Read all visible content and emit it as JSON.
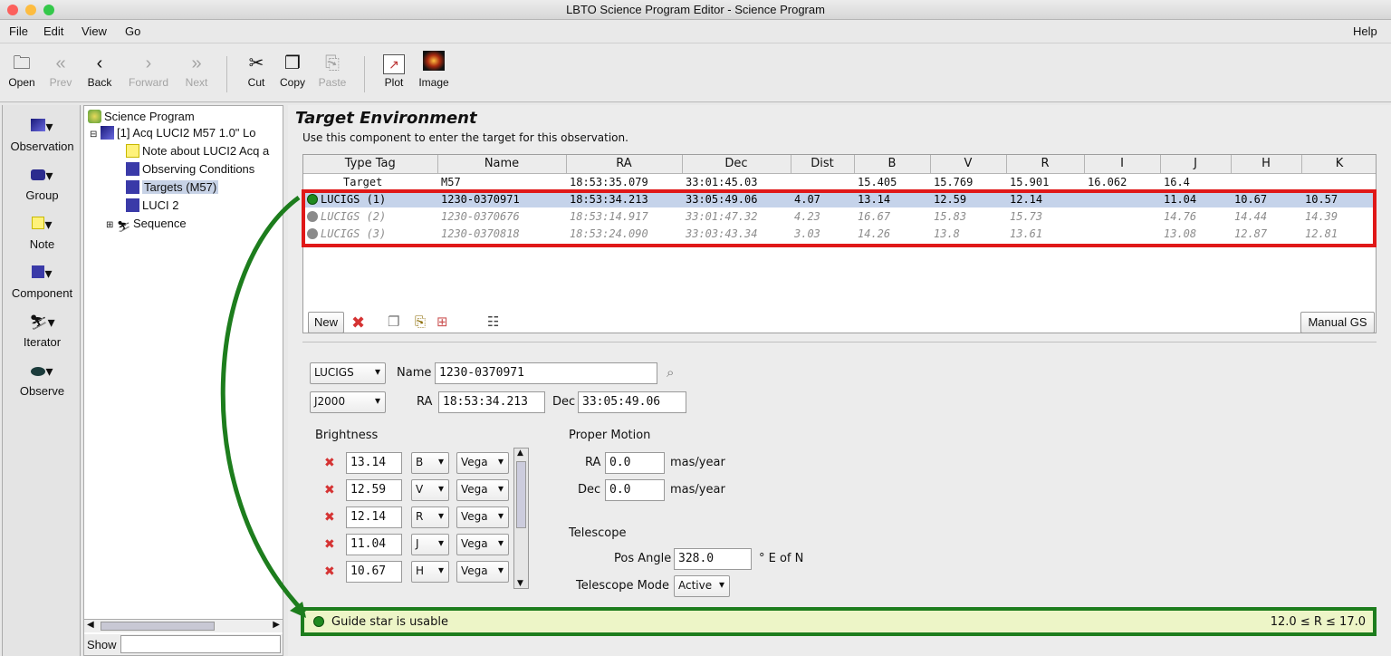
{
  "window": {
    "title": "LBTO Science Program Editor - Science Program"
  },
  "menu": {
    "file": "File",
    "edit": "Edit",
    "view": "View",
    "go": "Go",
    "help": "Help"
  },
  "toolbar": {
    "open": "Open",
    "prev": "Prev",
    "back": "Back",
    "forward": "Forward",
    "next": "Next",
    "cut": "Cut",
    "copy": "Copy",
    "paste": "Paste",
    "plot": "Plot",
    "image": "Image"
  },
  "palette": {
    "observation": "Observation",
    "group": "Group",
    "note": "Note",
    "component": "Component",
    "iterator": "Iterator",
    "observe": "Observe"
  },
  "tree": {
    "root": "Science Program",
    "obs": "[1] Acq LUCI2 M57 1.0\" Lo",
    "note": "Note about LUCI2 Acq a",
    "conditions": "Observing Conditions",
    "targets": "Targets (M57)",
    "luci": "LUCI 2",
    "sequence": "Sequence",
    "show_label": "Show"
  },
  "target_env": {
    "heading": "Target Environment",
    "subtitle": "Use this component to enter the target for this observation.",
    "columns": [
      "Type Tag",
      "Name",
      "RA",
      "Dec",
      "Dist",
      "B",
      "V",
      "R",
      "I",
      "J",
      "H",
      "K"
    ],
    "rows": [
      {
        "tag": "Target",
        "name": "M57",
        "ra": "18:53:35.079",
        "dec": "33:01:45.03",
        "dist": "",
        "b": "15.405",
        "v": "15.769",
        "r": "15.901",
        "i": "16.062",
        "j": "16.4",
        "h": "",
        "k": ""
      },
      {
        "tag": "LUCIGS (1)",
        "name": "1230-0370971",
        "ra": "18:53:34.213",
        "dec": "33:05:49.06",
        "dist": "4.07",
        "b": "13.14",
        "v": "12.59",
        "r": "12.14",
        "i": "",
        "j": "11.04",
        "h": "10.67",
        "k": "10.57"
      },
      {
        "tag": "LUCIGS (2)",
        "name": "1230-0370676",
        "ra": "18:53:14.917",
        "dec": "33:01:47.32",
        "dist": "4.23",
        "b": "16.67",
        "v": "15.83",
        "r": "15.73",
        "i": "",
        "j": "14.76",
        "h": "14.44",
        "k": "14.39"
      },
      {
        "tag": "LUCIGS (3)",
        "name": "1230-0370818",
        "ra": "18:53:24.090",
        "dec": "33:03:43.34",
        "dist": "3.03",
        "b": "14.26",
        "v": "13.8",
        "r": "13.61",
        "i": "",
        "j": "13.08",
        "h": "12.87",
        "k": "12.81"
      }
    ],
    "new_button": "New",
    "manual_gs_button": "Manual GS"
  },
  "detail": {
    "tag_value": "LUCIGS",
    "name_label": "Name",
    "name_value": "1230-0370971",
    "system_value": "J2000",
    "ra_label": "RA",
    "ra_value": "18:53:34.213",
    "dec_label": "Dec",
    "dec_value": "33:05:49.06",
    "brightness_label": "Brightness",
    "brightness": [
      {
        "value": "13.14",
        "band": "B",
        "system": "Vega"
      },
      {
        "value": "12.59",
        "band": "V",
        "system": "Vega"
      },
      {
        "value": "12.14",
        "band": "R",
        "system": "Vega"
      },
      {
        "value": "11.04",
        "band": "J",
        "system": "Vega"
      },
      {
        "value": "10.67",
        "band": "H",
        "system": "Vega"
      }
    ],
    "proper_motion_label": "Proper Motion",
    "pm_ra_label": "RA",
    "pm_ra_value": "0.0",
    "pm_dec_label": "Dec",
    "pm_dec_value": "0.0",
    "pm_unit": "mas/year",
    "telescope_label": "Telescope",
    "pos_angle_label": "Pos Angle",
    "pos_angle_value": "328.0",
    "pos_angle_unit": "° E of N",
    "mode_label": "Telescope Mode",
    "mode_value": "Active"
  },
  "status": {
    "message": "Guide star is usable",
    "range": "12.0 ≤ R ≤ 17.0"
  },
  "colors": {
    "highlight_red": "#e01818",
    "highlight_green": "#1d7d1d",
    "usable_dot": "#1f8a1f",
    "disabled_dot": "#8a8a8a",
    "selection": "#c5d3ea"
  }
}
